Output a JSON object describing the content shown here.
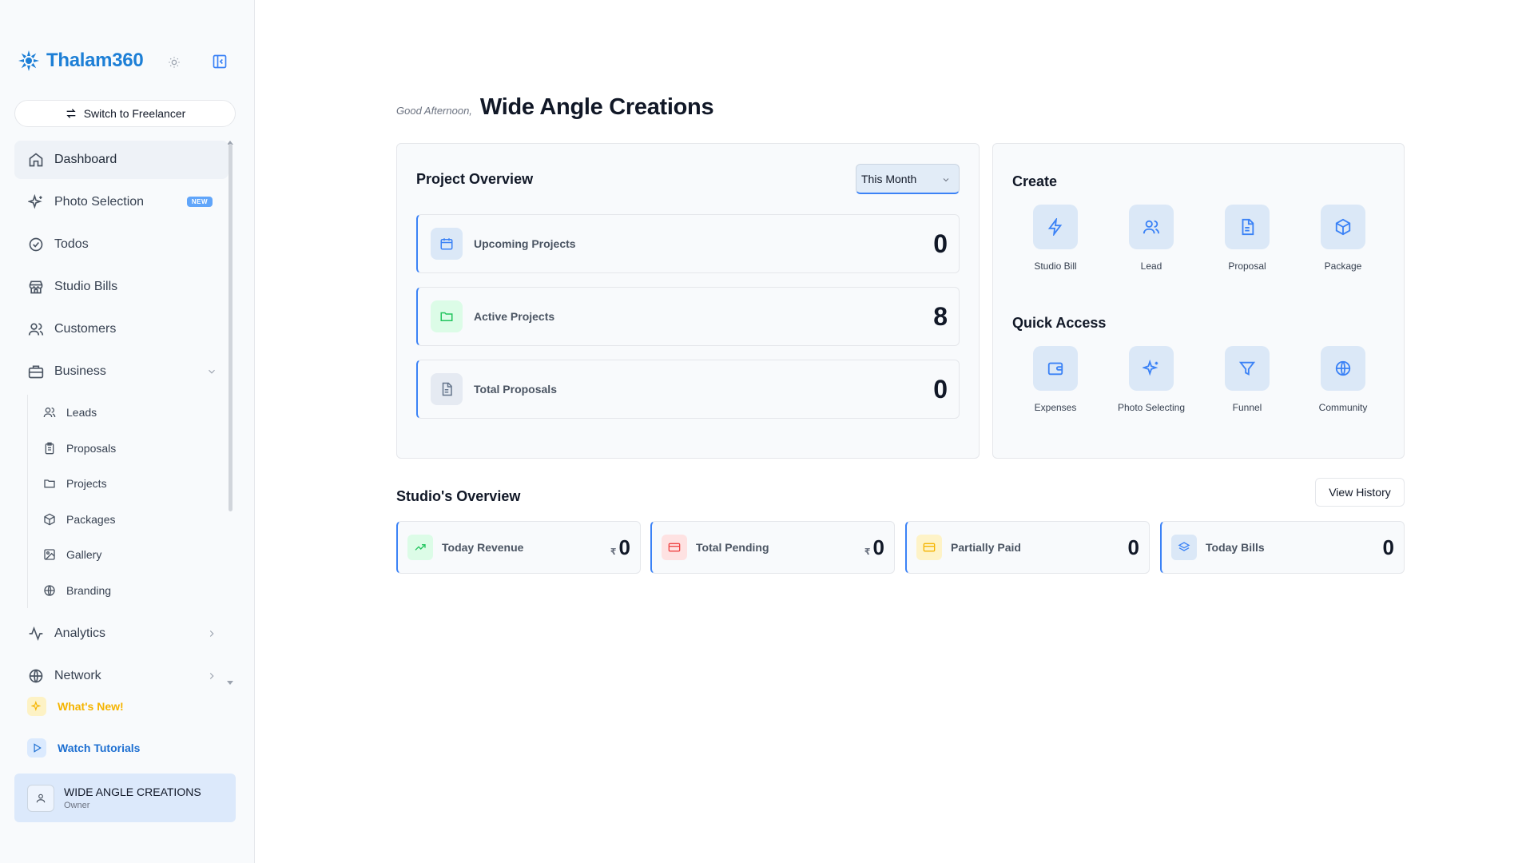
{
  "sidebar": {
    "brand_name": "Thalam360",
    "switch_label": "Switch to Freelancer",
    "nav": [
      {
        "label": "Dashboard",
        "icon": "home-icon"
      },
      {
        "label": "Photo Selection",
        "icon": "sparkles-icon",
        "badge": "NEW"
      },
      {
        "label": "Todos",
        "icon": "check-circle-icon"
      },
      {
        "label": "Studio Bills",
        "icon": "store-icon"
      },
      {
        "label": "Customers",
        "icon": "users-icon"
      },
      {
        "label": "Business",
        "icon": "briefcase-icon"
      }
    ],
    "business_sub": [
      {
        "label": "Leads",
        "icon": "users-icon"
      },
      {
        "label": "Proposals",
        "icon": "clipboard-icon"
      },
      {
        "label": "Projects",
        "icon": "folder-icon"
      },
      {
        "label": "Packages",
        "icon": "package-icon"
      },
      {
        "label": "Gallery",
        "icon": "image-icon"
      },
      {
        "label": "Branding",
        "icon": "globe-icon"
      }
    ],
    "nav_after": [
      {
        "label": "Analytics",
        "icon": "activity-icon"
      },
      {
        "label": "Network",
        "icon": "globe-icon"
      }
    ],
    "whats_new": "What's New!",
    "watch_tutorials": "Watch Tutorials",
    "user": {
      "name": "WIDE ANGLE CREATIONS",
      "role": "Owner"
    }
  },
  "header": {
    "greeting": "Good Afternoon,",
    "studio_name": "Wide Angle Creations"
  },
  "project_overview": {
    "title": "Project Overview",
    "period": "This Month",
    "stats": [
      {
        "label": "Upcoming Projects",
        "value": "0",
        "icon": "calendar-icon"
      },
      {
        "label": "Active Projects",
        "value": "8",
        "icon": "folder-icon"
      },
      {
        "label": "Total Proposals",
        "value": "0",
        "icon": "file-text-icon"
      }
    ]
  },
  "create": {
    "title": "Create",
    "items": [
      {
        "label": "Studio Bill",
        "icon": "zap-icon"
      },
      {
        "label": "Lead",
        "icon": "users-icon"
      },
      {
        "label": "Proposal",
        "icon": "file-text-icon"
      },
      {
        "label": "Package",
        "icon": "package-icon"
      }
    ]
  },
  "quick_access": {
    "title": "Quick Access",
    "items": [
      {
        "label": "Expenses",
        "icon": "wallet-icon"
      },
      {
        "label": "Photo Selecting",
        "icon": "sparkles-icon"
      },
      {
        "label": "Funnel",
        "icon": "filter-icon"
      },
      {
        "label": "Community",
        "icon": "globe-icon"
      }
    ]
  },
  "studio_overview": {
    "title": "Studio's Overview",
    "view_history": "View History",
    "currency": "₹",
    "cards": [
      {
        "label": "Today Revenue",
        "value": "0",
        "icon": "trending-up-icon",
        "currency": true
      },
      {
        "label": "Total Pending",
        "value": "0",
        "icon": "credit-card-icon",
        "currency": true
      },
      {
        "label": "Partially Paid",
        "value": "0",
        "icon": "card-icon",
        "currency": false
      },
      {
        "label": "Today Bills",
        "value": "0",
        "icon": "layers-icon",
        "currency": false
      }
    ]
  },
  "colors": {
    "brand": "#1d7fd6",
    "accent": "#3b82f6",
    "warning": "#f5b400",
    "success": "#22c55e",
    "danger": "#ef4444"
  }
}
